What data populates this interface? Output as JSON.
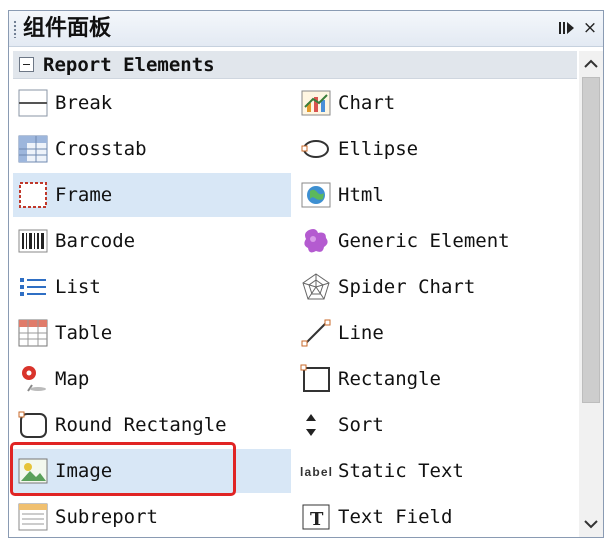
{
  "panel": {
    "title": "组件面板",
    "controls": {
      "dock_icon": "dock-icon",
      "close_glyph": "×"
    },
    "section": {
      "label": "Report Elements",
      "toggle_glyph": "−"
    },
    "scrollbar": {
      "up": "^",
      "down": "v"
    }
  },
  "items_left": [
    {
      "label": "Break",
      "icon": "break-icon"
    },
    {
      "label": "Crosstab",
      "icon": "crosstab-icon"
    },
    {
      "label": "Frame",
      "icon": "frame-icon",
      "selected": true
    },
    {
      "label": "Barcode",
      "icon": "barcode-icon"
    },
    {
      "label": "List",
      "icon": "list-icon"
    },
    {
      "label": "Table",
      "icon": "table-icon"
    },
    {
      "label": "Map",
      "icon": "map-pin-icon"
    },
    {
      "label": "Round Rectangle",
      "icon": "round-rectangle-icon"
    },
    {
      "label": "Image",
      "icon": "image-icon",
      "selected": true,
      "highlighted": true
    },
    {
      "label": "Subreport",
      "icon": "subreport-icon"
    }
  ],
  "items_right": [
    {
      "label": "Chart",
      "icon": "chart-icon"
    },
    {
      "label": "Ellipse",
      "icon": "ellipse-icon"
    },
    {
      "label": "Html",
      "icon": "html-globe-icon"
    },
    {
      "label": "Generic Element",
      "icon": "generic-element-icon"
    },
    {
      "label": "Spider Chart",
      "icon": "spider-chart-icon"
    },
    {
      "label": "Line",
      "icon": "line-icon"
    },
    {
      "label": "Rectangle",
      "icon": "rectangle-icon"
    },
    {
      "label": "Sort",
      "icon": "sort-icon"
    },
    {
      "label": "Static Text",
      "icon": "static-text-icon",
      "icon_text": "label"
    },
    {
      "label": "Text Field",
      "icon": "text-field-icon",
      "icon_text": "T"
    }
  ],
  "colors": {
    "selected_bg": "#d8e7f6",
    "highlight_border": "#e02424",
    "section_bg": "#e1e6ec"
  }
}
